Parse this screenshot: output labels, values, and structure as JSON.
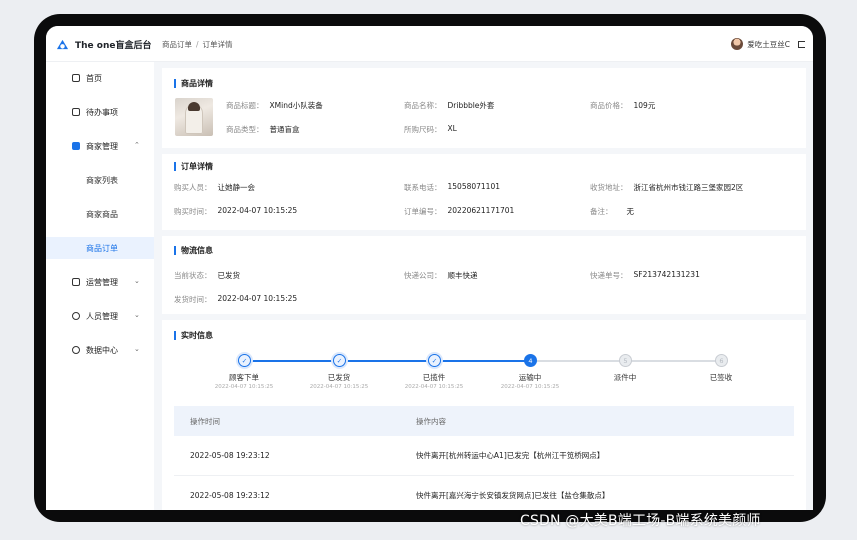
{
  "app": {
    "brand_name": "The one盲盒后台"
  },
  "breadcrumb": {
    "parent": "商品订单",
    "separator": "/",
    "current": "订单详情"
  },
  "user": {
    "name": "爱吃土豆丝C"
  },
  "sidebar": {
    "items": [
      {
        "label": "首页",
        "icon": "home-icon"
      },
      {
        "label": "待办事项",
        "icon": "todo-icon"
      },
      {
        "label": "商家管理",
        "icon": "shop-icon",
        "chevron": "⌃"
      },
      {
        "label": "运营管理",
        "icon": "operation-icon",
        "chevron": "⌄"
      },
      {
        "label": "人员管理",
        "icon": "people-icon",
        "chevron": "⌄"
      },
      {
        "label": "数据中心",
        "icon": "data-icon",
        "chevron": "⌄"
      }
    ],
    "sub_items": [
      {
        "label": "商家列表"
      },
      {
        "label": "商家商品"
      },
      {
        "label": "商品订单",
        "active": true
      }
    ],
    "active_color": "#1a73e8"
  },
  "product": {
    "title": "商品详情",
    "fields": {
      "title_k": "商品标题：",
      "title_v": "XMind小队装备",
      "name_k": "商品名称：",
      "name_v": "Dribbble外套",
      "price_k": "商品价格：",
      "price_v": "109元",
      "type_k": "商品类型：",
      "type_v": "普通盲盒",
      "size_k": "所购尺码：",
      "size_v": "XL"
    }
  },
  "order": {
    "title": "订单详情",
    "fields": {
      "buyer_k": "购买人员：",
      "buyer_v": "让她静一会",
      "phone_k": "联系电话：",
      "phone_v": "15058071101",
      "addr_k": "收货地址：",
      "addr_v": "浙江省杭州市钱江路三堡家园2区",
      "time_k": "购买时间：",
      "time_v": "2022-04-07 10:15:25",
      "no_k": "订单编号：",
      "no_v": "20220621171701",
      "note_k": "备注：",
      "note_v": "无"
    }
  },
  "logistics": {
    "title": "物流信息",
    "fields": {
      "status_k": "当前状态：",
      "status_v": "已发货",
      "company_k": "快递公司：",
      "company_v": "顺丰快递",
      "tracking_k": "快递单号：",
      "tracking_v": "SF213742131231",
      "ship_k": "发货时间：",
      "ship_v": "2022-04-07 10:15:25"
    }
  },
  "realtime": {
    "title": "实时信息",
    "steps": [
      {
        "label": "顾客下单",
        "time": "2022-04-07 10:15:25",
        "state": "done",
        "mark": "✓"
      },
      {
        "label": "已发货",
        "time": "2022-04-07 10:15:25",
        "state": "done",
        "mark": "✓"
      },
      {
        "label": "已揽件",
        "time": "2022-04-07 10:15:25",
        "state": "done",
        "mark": "✓"
      },
      {
        "label": "运输中",
        "time": "2022-04-07 10:15:25",
        "state": "current",
        "mark": "4"
      },
      {
        "label": "派件中",
        "time": "",
        "state": "todo",
        "mark": "5"
      },
      {
        "label": "已签收",
        "time": "",
        "state": "todo",
        "mark": "6"
      }
    ],
    "table": {
      "headers": {
        "time": "操作时间",
        "content": "操作内容"
      },
      "rows": [
        {
          "time": "2022-05-08 19:23:12",
          "content": "快件离开[杭州转运中心A1]已发完【杭州江干笕桥网点】"
        },
        {
          "time": "2022-05-08 19:23:12",
          "content": "快件离开[嘉兴海宁长安镇发货网点]已发往【盐仓集散点】"
        }
      ]
    }
  },
  "watermark": "CSDN @大美B端工场-B端系统美颜师"
}
